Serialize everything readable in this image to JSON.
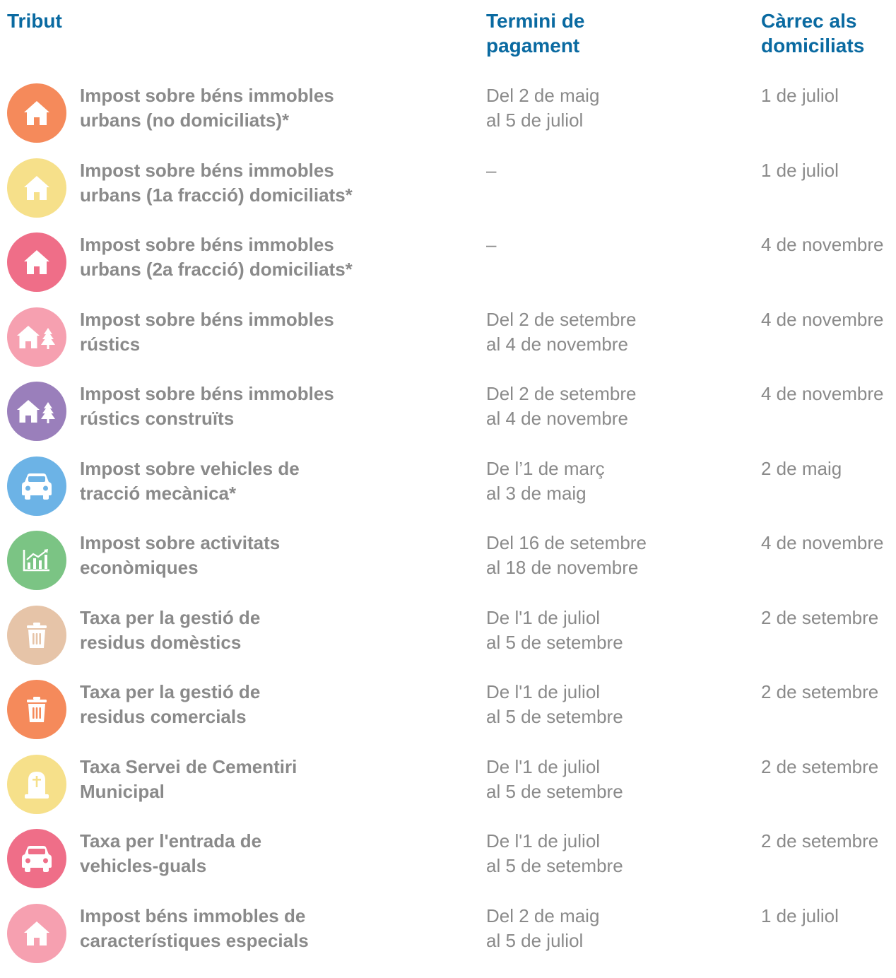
{
  "headers": {
    "tribut": "Tribut",
    "termini": "Termini de\npagament",
    "carrec": "Càrrec als\ndomiciliats"
  },
  "rows": [
    {
      "icon": "house-icon",
      "color": "#f58a5b",
      "name": "Impost sobre béns immobles\nurbans (no domiciliats)*",
      "term": "Del 2 de maig\nal 5 de juliol",
      "charge": "1 de juliol"
    },
    {
      "icon": "house-icon",
      "color": "#f6e08a",
      "name": "Impost sobre béns immobles\nurbans (1a fracció) domiciliats*",
      "term": "–",
      "charge": "1 de juliol"
    },
    {
      "icon": "house-icon",
      "color": "#ef6e88",
      "name": "Impost sobre béns immobles\nurbans (2a fracció) domiciliats*",
      "term": "–",
      "charge": "4 de novembre"
    },
    {
      "icon": "house-tree-icon",
      "color": "#f6a0b0",
      "name": "Impost sobre béns immobles\nrústics",
      "term": "Del 2 de setembre\nal 4 de novembre",
      "charge": "4 de novembre"
    },
    {
      "icon": "house-tree-icon",
      "color": "#9a7fbb",
      "name": "Impost sobre béns immobles\nrústics construïts",
      "term": "Del 2 de setembre\nal 4 de novembre",
      "charge": "4 de novembre"
    },
    {
      "icon": "car-icon",
      "color": "#6cb3e6",
      "name": "Impost sobre vehicles de\ntracció mecànica*",
      "term": "De l’1 de març\nal 3 de maig",
      "charge": "2 de maig"
    },
    {
      "icon": "chart-icon",
      "color": "#7bc484",
      "name": "Impost sobre activitats\neconòmiques",
      "term": "Del 16 de setembre\nal 18 de novembre",
      "charge": "4 de novembre"
    },
    {
      "icon": "trash-icon",
      "color": "#e6c4a8",
      "name": "Taxa per la gestió de\nresidus domèstics",
      "term": "De l'1 de juliol\nal 5 de setembre",
      "charge": "2 de setembre"
    },
    {
      "icon": "trash-icon",
      "color": "#f58a5b",
      "name": "Taxa per la gestió de\nresidus comercials",
      "term": "De l'1 de juliol\nal 5 de setembre",
      "charge": "2 de setembre"
    },
    {
      "icon": "gravestone-icon",
      "color": "#f6e08a",
      "name": "Taxa Servei de Cementiri\nMunicipal",
      "term": "De l'1 de juliol\nal 5 de setembre",
      "charge": "2 de setembre"
    },
    {
      "icon": "car-icon",
      "color": "#ef6e88",
      "name": "Taxa per l'entrada de\nvehicles-guals",
      "term": "De l'1 de juliol\nal 5 de setembre",
      "charge": "2 de setembre"
    },
    {
      "icon": "house-icon",
      "color": "#f6a0b0",
      "name": "Impost béns immobles de\ncaracterístiques especials",
      "term": "Del 2 de maig\nal 5 de juliol",
      "charge": "1 de juliol"
    }
  ]
}
